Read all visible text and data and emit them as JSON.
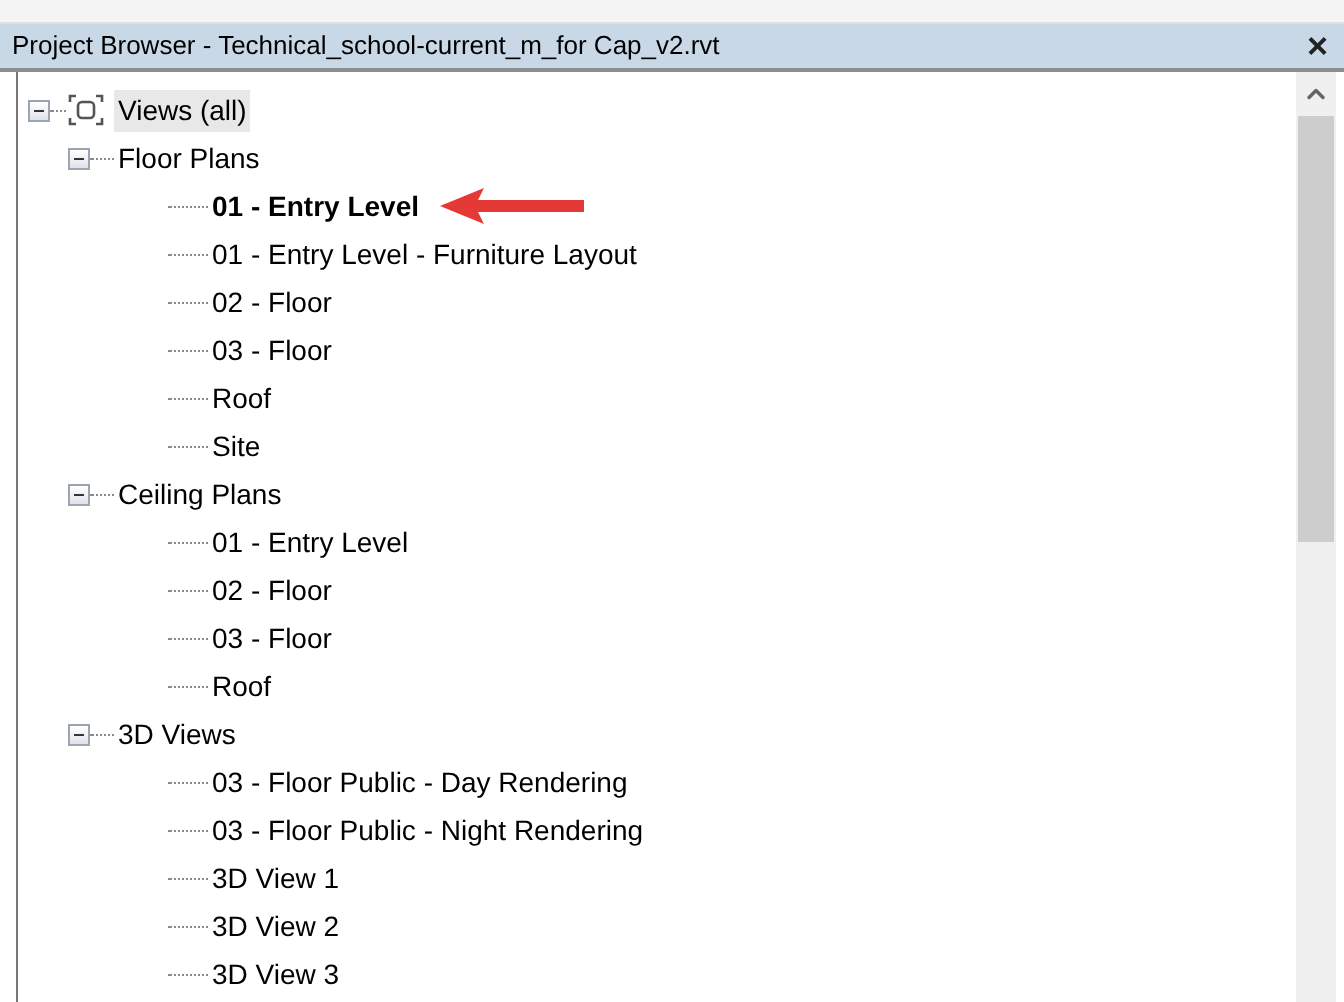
{
  "window": {
    "title": "Project Browser - Technical_school-current_m_for Cap_v2.rvt",
    "close": "×"
  },
  "tree": {
    "label": "Views (all)",
    "expanded": true,
    "children": [
      {
        "label": "Floor Plans",
        "expanded": true,
        "children": [
          {
            "label": "01 - Entry Level",
            "active": true
          },
          {
            "label": "01 - Entry Level - Furniture Layout",
            "active": false
          },
          {
            "label": "02 - Floor",
            "active": false
          },
          {
            "label": "03 - Floor",
            "active": false
          },
          {
            "label": "Roof",
            "active": false
          },
          {
            "label": "Site",
            "active": false
          }
        ]
      },
      {
        "label": "Ceiling Plans",
        "expanded": true,
        "children": [
          {
            "label": "01 - Entry Level",
            "active": false
          },
          {
            "label": "02 - Floor",
            "active": false
          },
          {
            "label": "03 - Floor",
            "active": false
          },
          {
            "label": "Roof",
            "active": false
          }
        ]
      },
      {
        "label": "3D Views",
        "expanded": true,
        "children": [
          {
            "label": "03 - Floor Public - Day Rendering",
            "active": false
          },
          {
            "label": "03 - Floor Public - Night Rendering",
            "active": false
          },
          {
            "label": "3D View 1",
            "active": false
          },
          {
            "label": "3D View 2",
            "active": false
          },
          {
            "label": "3D View 3",
            "active": false
          }
        ]
      }
    ]
  }
}
